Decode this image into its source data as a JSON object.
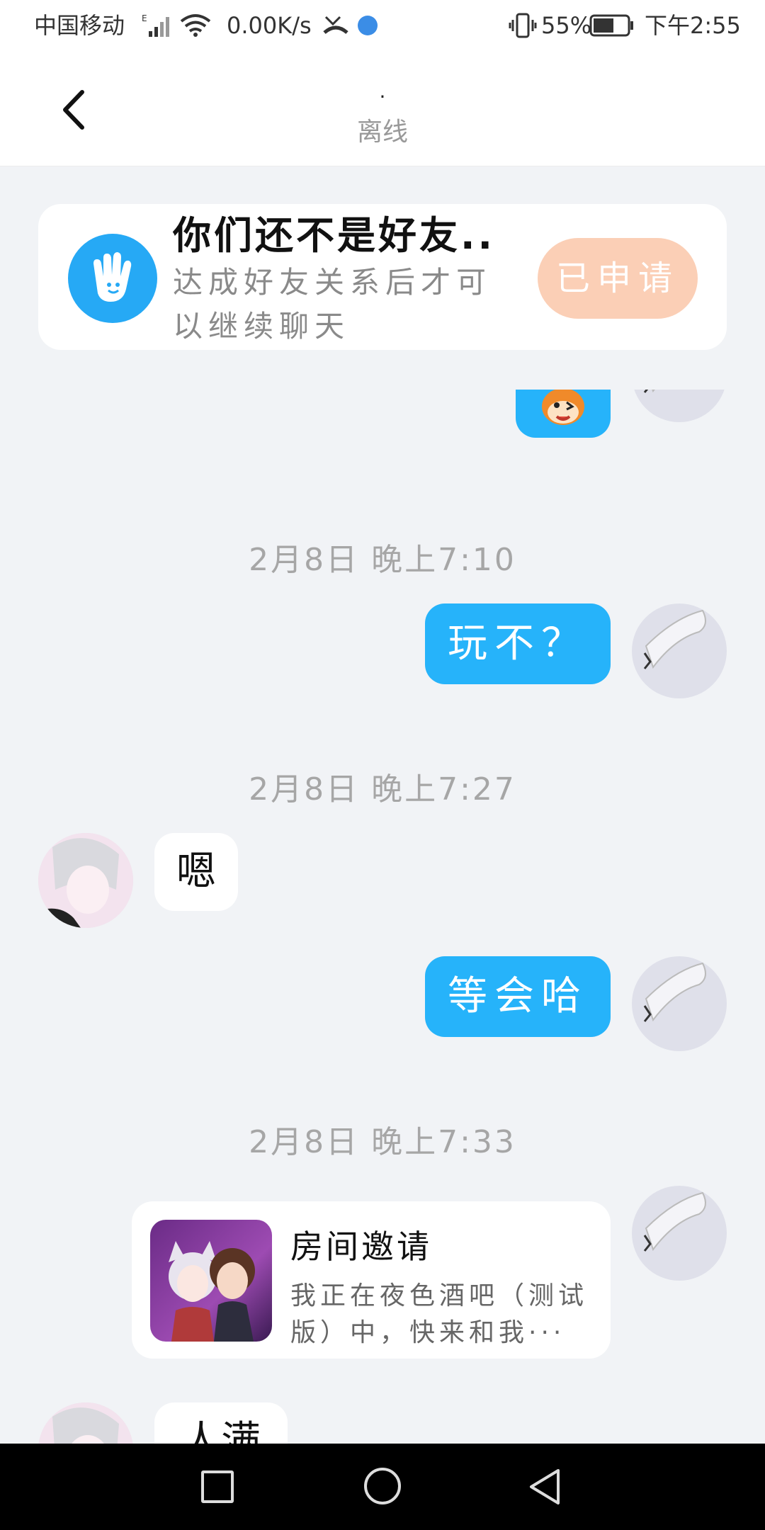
{
  "status_bar": {
    "carrier": "中国移动",
    "network_speed": "0.00K/s",
    "battery": "55%",
    "time": "下午2:55"
  },
  "header": {
    "title": ".",
    "subtitle": "离线"
  },
  "friend_banner": {
    "title": "你们还不是好友..",
    "description": "达成好友关系后才可以继续聊天",
    "button": "已申请"
  },
  "messages": [
    {
      "type": "sticker",
      "sender": "me"
    },
    {
      "type": "timestamp",
      "text": "2月8日 晚上7:10"
    },
    {
      "type": "text",
      "sender": "me",
      "text": "玩不？"
    },
    {
      "type": "timestamp",
      "text": "2月8日 晚上7:27"
    },
    {
      "type": "text",
      "sender": "other",
      "text": "嗯"
    },
    {
      "type": "text",
      "sender": "me",
      "text": "等会哈"
    },
    {
      "type": "timestamp",
      "text": "2月8日 晚上7:33"
    },
    {
      "type": "invite",
      "sender": "me",
      "title": "房间邀请",
      "description": "我正在夜色酒吧（测试版）中，快来和我···"
    },
    {
      "type": "text",
      "sender": "other",
      "text": "人满"
    }
  ],
  "colors": {
    "accent": "#26b3fa",
    "applied_button": "#fbcfb6",
    "background": "#f1f3f6"
  },
  "icons": {
    "back": "chevron-left-icon",
    "banner": "hand-wave-icon",
    "nav_recent": "square-icon",
    "nav_home": "circle-icon",
    "nav_back": "triangle-back-icon"
  }
}
